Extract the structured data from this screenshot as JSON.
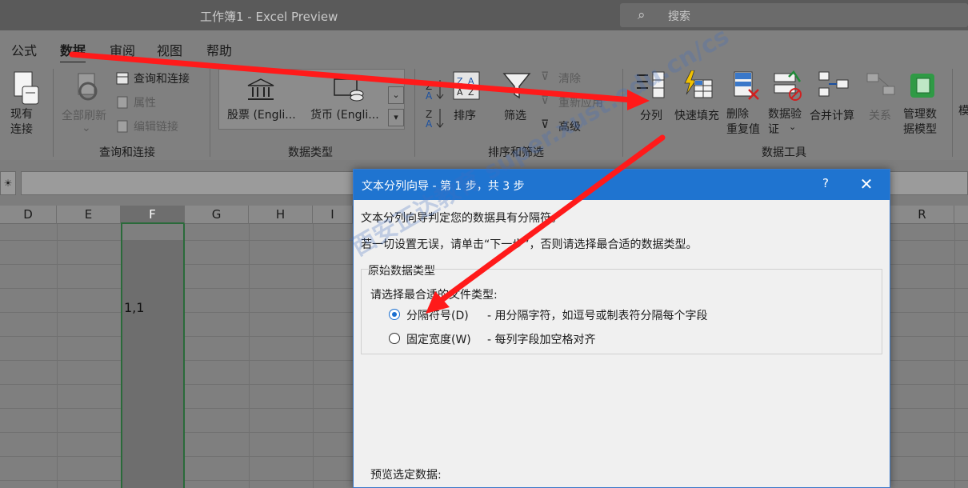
{
  "app": {
    "title": "工作簿1  -  Excel Preview",
    "search_placeholder": "搜索"
  },
  "tabs": [
    "公式",
    "数据",
    "审阅",
    "视图",
    "帮助"
  ],
  "active_tab": "数据",
  "ribbon": {
    "existing_connections": "现有\n连接",
    "refresh_all": "全部刷新",
    "refresh_all_dropdown": "⌄",
    "queries_and_connections": "查询和连接",
    "properties": "属性",
    "edit_links": "编辑链接",
    "group_queries": "查询和连接",
    "stocks": "股票 (Engli...",
    "currencies": "货币 (Engli...",
    "group_data_types": "数据类型",
    "sort": "排序",
    "filter": "筛选",
    "clear": "清除",
    "reapply": "重新应用",
    "advanced": "高级",
    "group_sort_filter": "排序和筛选",
    "text_to_columns": "分列",
    "flash_fill": "快速填充",
    "remove_duplicates": "删除\n重复值",
    "data_validation": "数据验\n证",
    "data_validation_dropdown": "⌄",
    "consolidate": "合并计算",
    "relationships": "关系",
    "manage_data_model": "管理数\n据模型",
    "more": "模",
    "group_data_tools": "数据工具"
  },
  "columns": [
    "D",
    "E",
    "F",
    "G",
    "H",
    "I",
    "R"
  ],
  "selected_column": "F",
  "cells": {
    "F5": "1,1"
  },
  "dialog": {
    "title": "文本分列向导 - 第 1 步，共 3 步",
    "help": "?",
    "close": "✕",
    "intro": "文本分列向导判定您的数据具有分隔符。",
    "hint": "若一切设置无误，请单击“下一步”，否则请选择最合适的数据类型。",
    "group_title": "原始数据类型",
    "prompt": "请选择最合适的文件类型:",
    "options": [
      {
        "label": "分隔符号(D)",
        "desc": "- 用分隔字符，如逗号或制表符分隔每个字段",
        "selected": true
      },
      {
        "label": "固定宽度(W)",
        "desc": "- 每列字段加空格对齐",
        "selected": false
      }
    ],
    "preview_label": "预览选定数据:"
  },
  "watermark": "西安正达教育 super.xust.edu.cn/cs",
  "colors": {
    "annotation_arrow": "#ff1a1a",
    "dialog_titlebar": "#1f74d0",
    "selection_border": "#2a6a3a"
  }
}
